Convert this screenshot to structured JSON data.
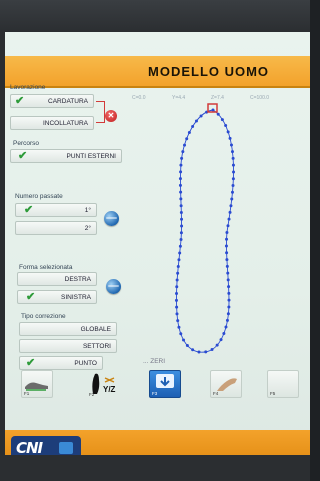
{
  "header": {
    "title": "MODELLO  UOMO"
  },
  "lavorazione": {
    "label": "Lavorazione",
    "cardatura": "CARDATURA",
    "incollatura": "INCOLLATURA"
  },
  "percorso": {
    "label": "Percorso",
    "value": "PUNTI ESTERNI"
  },
  "numero_passate": {
    "label": "Numero passate",
    "first": "1°",
    "second": "2°"
  },
  "forma": {
    "label": "Forma selezionata",
    "destra": "DESTRA",
    "sinistra": "SINISTRA"
  },
  "correzione": {
    "label": "Tipo correzione",
    "globale": "GLOBALE",
    "settori": "SETTORI",
    "punto": "PUNTO",
    "extra": "... ZERI"
  },
  "coords": {
    "c1": "C=0.0",
    "c2": "Y=4.4",
    "c3": "Z=7.4",
    "c4": "C=100.0"
  },
  "tools": {
    "t1": "F1",
    "t2": "F2",
    "t2_label": "Y/Z",
    "t3": "F3",
    "t4": "F4",
    "t5": "F5"
  },
  "footer": {
    "logo": "CNI"
  },
  "colors": {
    "header": "#f3a22b",
    "check": "#2e9b3a",
    "path": "#2a4bd1",
    "close": "#c01d1d"
  }
}
